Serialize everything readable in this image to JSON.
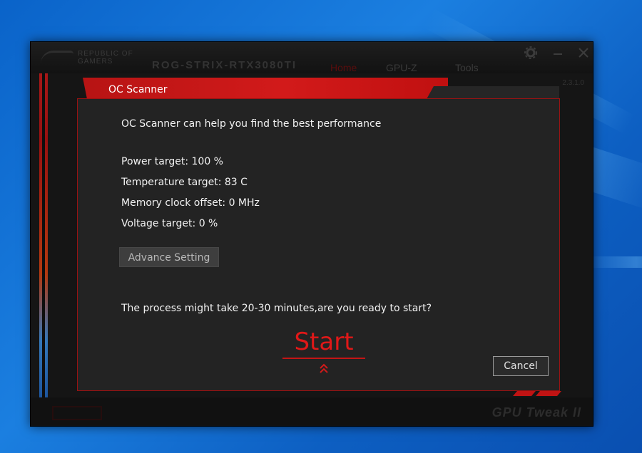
{
  "app": {
    "brand": "REPUBLIC OF GAMERS",
    "model": "ROG-STRIX-RTX3080TI",
    "tabs": [
      {
        "label": "Home",
        "active": true
      },
      {
        "label": "GPU-Z",
        "active": false
      },
      {
        "label": "Tools",
        "active": false
      }
    ],
    "version": "2.3.1.0",
    "watermark": "GPU Tweak II",
    "controls": [
      "gear-icon",
      "minimize-icon",
      "close-icon"
    ]
  },
  "dialog": {
    "title": "OC Scanner",
    "intro": "OC Scanner can help you find the best performance",
    "settings": [
      "Power target: 100 %",
      "Temperature target: 83 C",
      "Memory clock offset: 0 MHz",
      "Voltage target: 0 %"
    ],
    "advance_label": "Advance Setting",
    "question": "The process might take 20-30 minutes,are you ready to start?",
    "start_label": "Start",
    "cancel_label": "Cancel"
  },
  "colors": {
    "accent_red": "#d21a1a",
    "dialog_bg": "#232323",
    "window_bg": "#151515",
    "desktop_blue": "#1b7fe0"
  }
}
